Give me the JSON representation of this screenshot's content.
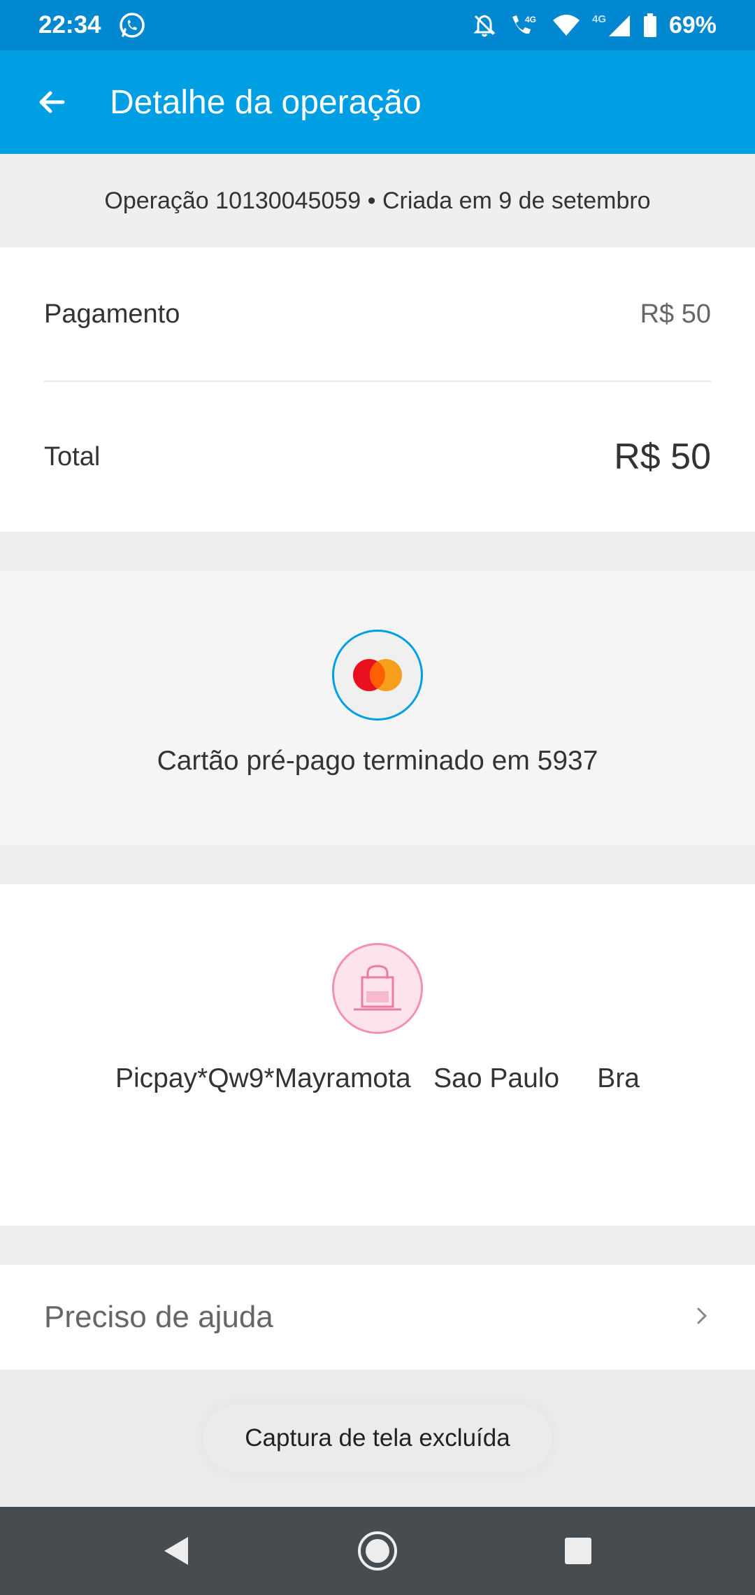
{
  "status_bar": {
    "time": "22:34",
    "battery": "69%",
    "network": "4G",
    "icons": [
      "whatsapp-icon",
      "bell-off-icon",
      "volte-call-icon",
      "wifi-icon",
      "signal-icon",
      "battery-icon"
    ]
  },
  "app_bar": {
    "title": "Detalhe da operação",
    "back_icon": "arrow-left-icon",
    "background": "#009ee3"
  },
  "operation": {
    "header": "Operação 10130045059 • Criada em 9 de setembro"
  },
  "summary": {
    "payment_label": "Pagamento",
    "payment_value": "R$ 50",
    "total_label": "Total",
    "total_value": "R$ 50"
  },
  "payment_method": {
    "icon": "mastercard-icon",
    "text": "Cartão pré-pago terminado em 5937"
  },
  "merchant": {
    "icon": "shopping-bag-icon",
    "text": "Picpay*Qw9*Mayramota   Sao Paulo     Bra"
  },
  "help": {
    "label": "Preciso de ajuda",
    "icon": "chevron-right-icon"
  },
  "toast": {
    "text": "Captura de tela excluída"
  },
  "nav_bar": {
    "icons": [
      "back-triangle-icon",
      "home-circle-icon",
      "recents-square-icon"
    ]
  }
}
